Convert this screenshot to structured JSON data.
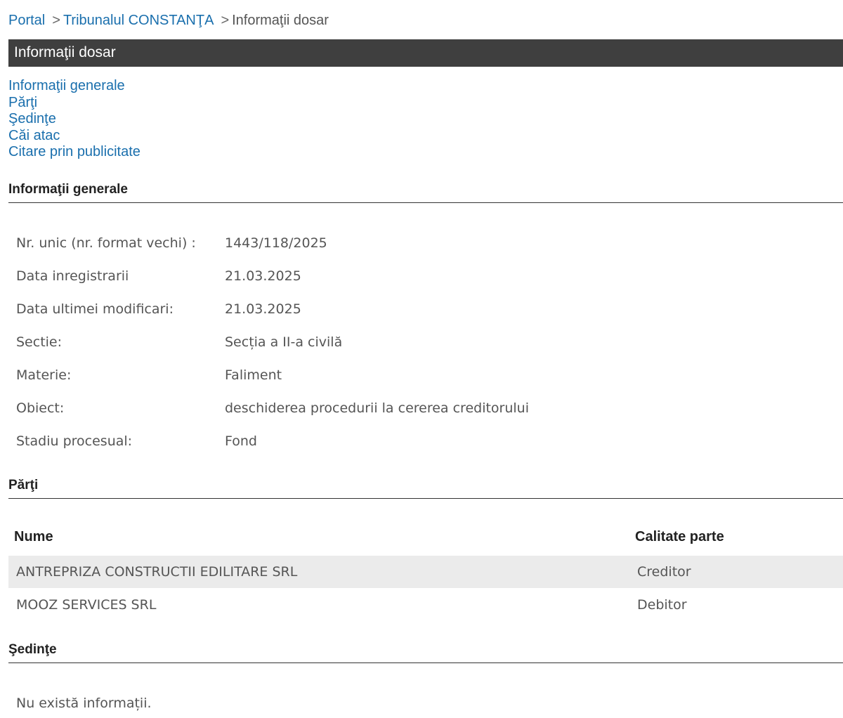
{
  "breadcrumb": {
    "items": [
      {
        "label": "Portal"
      },
      {
        "label": "Tribunalul CONSTANŢA"
      },
      {
        "label": "Informaţii dosar"
      }
    ],
    "separator": ">"
  },
  "title": "Informaţii dosar",
  "nav": {
    "links": [
      {
        "label": "Informaţii generale"
      },
      {
        "label": "Părţi"
      },
      {
        "label": "Şedinţe"
      },
      {
        "label": "Căi atac"
      },
      {
        "label": "Citare prin publicitate"
      }
    ]
  },
  "general": {
    "heading": "Informaţii generale",
    "rows": [
      {
        "label": "Nr. unic (nr. format vechi) :",
        "value": "1443/118/2025"
      },
      {
        "label": "Data inregistrarii",
        "value": "21.03.2025"
      },
      {
        "label": "Data ultimei modificari:",
        "value": "21.03.2025"
      },
      {
        "label": "Sectie:",
        "value": "Secția a II-a civilă"
      },
      {
        "label": "Materie:",
        "value": "Faliment"
      },
      {
        "label": "Obiect:",
        "value": "deschiderea procedurii la cererea creditorului"
      },
      {
        "label": "Stadiu procesual:",
        "value": "Fond"
      }
    ]
  },
  "parti": {
    "heading": "Părţi",
    "columns": [
      "Nume",
      "Calitate parte"
    ],
    "rows": [
      {
        "nume": "ANTREPRIZA CONSTRUCTII EDILITARE SRL",
        "calitate": "Creditor"
      },
      {
        "nume": "MOOZ SERVICES SRL",
        "calitate": "Debitor"
      }
    ]
  },
  "sedinte": {
    "heading": "Şedinţe",
    "empty_message": "Nu există informații."
  }
}
